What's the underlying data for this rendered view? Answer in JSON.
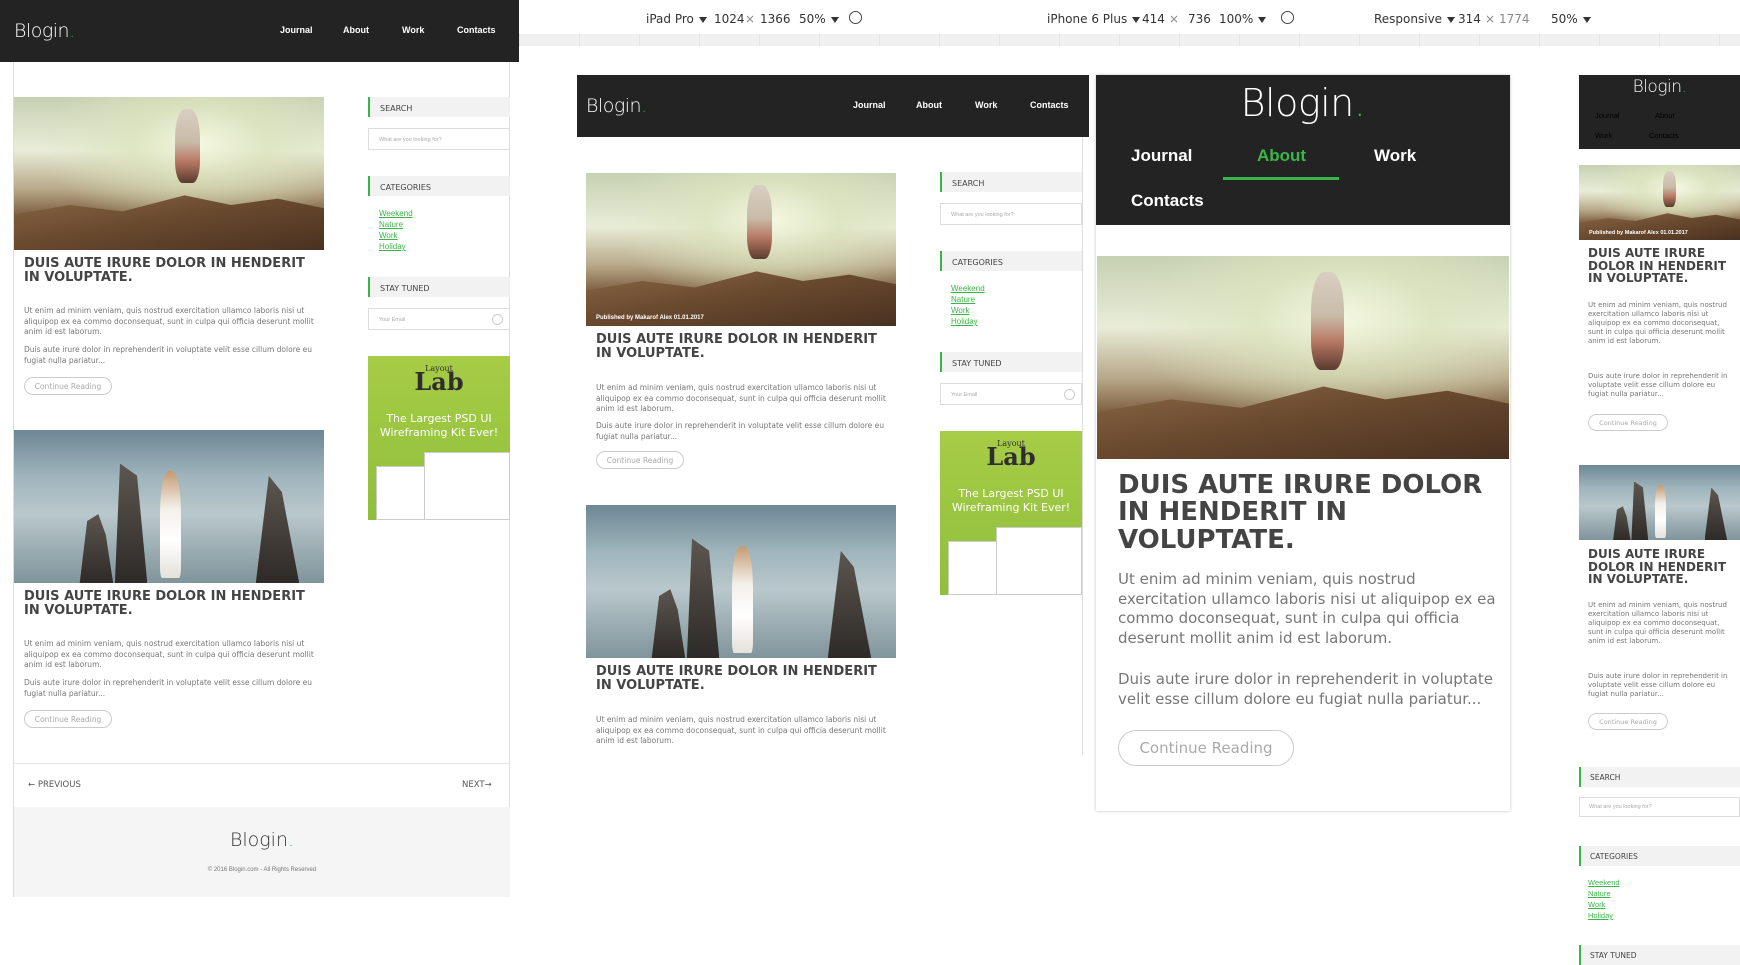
{
  "brand": {
    "name": "Blogin",
    "dot": "."
  },
  "nav": [
    "Journal",
    "About",
    "Work",
    "Contacts"
  ],
  "devtools": {
    "ipad": {
      "device": "iPad Pro",
      "width": "1024",
      "height": "1366",
      "zoom": "50%"
    },
    "iphone": {
      "device": "iPhone 6 Plus",
      "width": "414",
      "height": "736",
      "zoom": "100%"
    },
    "responsive": {
      "device": "Responsive",
      "width": "314",
      "height": "1774",
      "zoom": "50%"
    },
    "x_sep": "×"
  },
  "sidebar": {
    "search_title": "Search",
    "search_placeholder": "What are you looking for?",
    "categories_title": "Categories",
    "categories": [
      "Weekend",
      "Nature",
      "Work",
      "Holiday"
    ],
    "stay_tuned_title": "Stay Tuned",
    "email_placeholder": "Your Email"
  },
  "ad": {
    "title_small": "Layout",
    "title_big": "Lab",
    "tagline": "The Largest PSD UI Wireframing Kit Ever!"
  },
  "post": {
    "title": "DUIS AUTE IRURE DOLOR IN HENDERIT IN VOLUPTATE.",
    "p1": "Ut enim ad minim veniam, quis nostrud exercitation ullamco laboris nisi ut aliquipop ex ea commo doconsequat, sunt in culpa qui officia deserunt mollit anim id est laborum.",
    "p2": "Duis aute irure dolor in reprehenderit in voluptate velit esse cillum dolore eu fugiat nulla pariatur...",
    "button": "Continue Reading",
    "published": "Published by Makarof Alex 01.01.2017"
  },
  "pagination": {
    "prev": "← PREVIOUS",
    "next": "NEXT→"
  },
  "footer": {
    "copyright": "© 2016 Blogin.com - All Rights Reserved"
  },
  "colors": {
    "accent": "#3bb54a",
    "header": "#232323"
  }
}
